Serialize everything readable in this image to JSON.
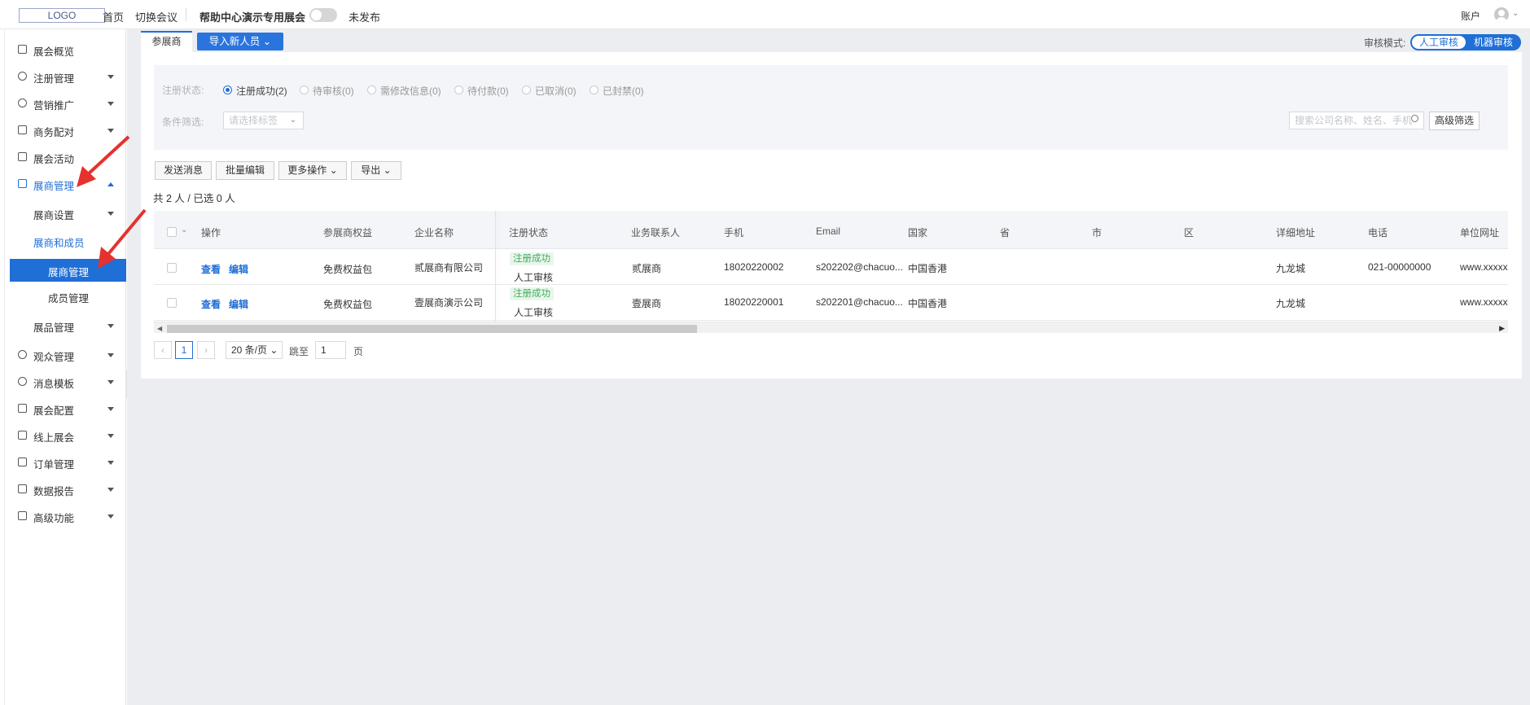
{
  "topbar": {
    "logo": "LOGO",
    "home": "首页",
    "switch_meeting": "切换会议",
    "event_name": "帮助中心演示专用展会",
    "publish_status": "未发布",
    "account": "账户"
  },
  "sidebar": {
    "items": [
      {
        "label": "展会概览",
        "icon": "overview-icon"
      },
      {
        "label": "注册管理",
        "icon": "user-icon"
      },
      {
        "label": "营销推广",
        "icon": "clock-icon"
      },
      {
        "label": "商务配对",
        "icon": "match-icon"
      },
      {
        "label": "展会活动",
        "icon": "flag-icon"
      },
      {
        "label": "展商管理",
        "icon": "exhibitor-icon"
      },
      {
        "label": "展商设置"
      },
      {
        "label": "展商和成员"
      },
      {
        "label": "展商管理"
      },
      {
        "label": "成员管理"
      },
      {
        "label": "展品管理"
      },
      {
        "label": "观众管理",
        "icon": "database-icon"
      },
      {
        "label": "消息模板",
        "icon": "bell-icon"
      },
      {
        "label": "展会配置",
        "icon": "config-icon"
      },
      {
        "label": "线上展会",
        "icon": "monitor-icon"
      },
      {
        "label": "订单管理",
        "icon": "order-icon"
      },
      {
        "label": "数据报告",
        "icon": "report-icon"
      },
      {
        "label": "高级功能",
        "icon": "grid-icon"
      }
    ]
  },
  "tabs": {
    "active": "参展商",
    "import_button": "导入新人员 ⌄"
  },
  "audit_mode": {
    "label": "审核模式:",
    "manual": "人工审核",
    "machine": "机器审核"
  },
  "filter": {
    "status_label": "注册状态:",
    "statuses": [
      {
        "label": "注册成功(2)",
        "selected": true
      },
      {
        "label": "待审核(0)",
        "selected": false
      },
      {
        "label": "需修改信息(0)",
        "selected": false
      },
      {
        "label": "待付款(0)",
        "selected": false
      },
      {
        "label": "已取消(0)",
        "selected": false
      },
      {
        "label": "已封禁(0)",
        "selected": false
      }
    ],
    "condition_label": "条件筛选:",
    "tag_placeholder": "请选择标签",
    "search_placeholder": "搜索公司名称、姓名、手机",
    "advanced": "高级筛选"
  },
  "actions": {
    "send_message": "发送消息",
    "batch_edit": "批量编辑",
    "more": "更多操作 ⌄",
    "export": "导出 ⌄"
  },
  "count_text": "共 2 人 / 已选 0 人",
  "table": {
    "headers": [
      "操作",
      "参展商权益",
      "企业名称",
      "注册状态",
      "业务联系人",
      "手机",
      "Email",
      "国家",
      "省",
      "市",
      "区",
      "详细地址",
      "电话",
      "单位网址"
    ],
    "view": "查看",
    "edit": "编辑",
    "rows": [
      {
        "benefit": "免费权益包",
        "company": "贰展商有限公司",
        "status": "注册成功",
        "review": "人工审核",
        "contact": "贰展商",
        "phone": "18020220002",
        "email": "s202202@chacuo...",
        "country": "中国香港",
        "province": "",
        "city": "",
        "district": "",
        "address": "九龙城",
        "tel": "021-00000000",
        "website": "www.xxxxx"
      },
      {
        "benefit": "免费权益包",
        "company": "壹展商演示公司",
        "status": "注册成功",
        "review": "人工审核",
        "contact": "壹展商",
        "phone": "18020220001",
        "email": "s202201@chacuo...",
        "country": "中国香港",
        "province": "",
        "city": "",
        "district": "",
        "address": "九龙城",
        "tel": "",
        "website": "www.xxxxx"
      }
    ]
  },
  "pagination": {
    "current": "1",
    "page_size": "20 条/页 ⌄",
    "jump_label": "跳至",
    "jump_value": "1",
    "page_unit": "页"
  },
  "colors": {
    "accent": "#1f6fd6",
    "success": "#3fae5c",
    "annotation_arrow": "#e5322d"
  }
}
